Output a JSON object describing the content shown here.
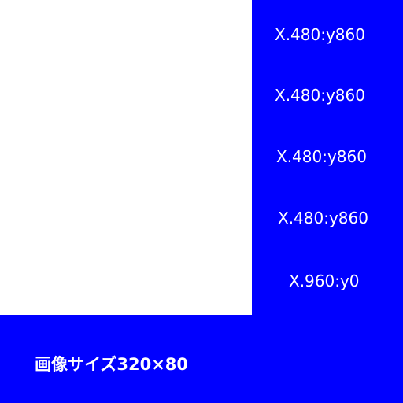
{
  "colors": {
    "background_blue": "#0000ff",
    "panel_white": "#ffffff",
    "text_white": "#ffffff"
  },
  "coordinate_labels": [
    "X.480:y860",
    "X.480:y860",
    "X.480:y860",
    "X.480:y860",
    "X.960:y0"
  ],
  "caption": "画像サイズ320×80"
}
